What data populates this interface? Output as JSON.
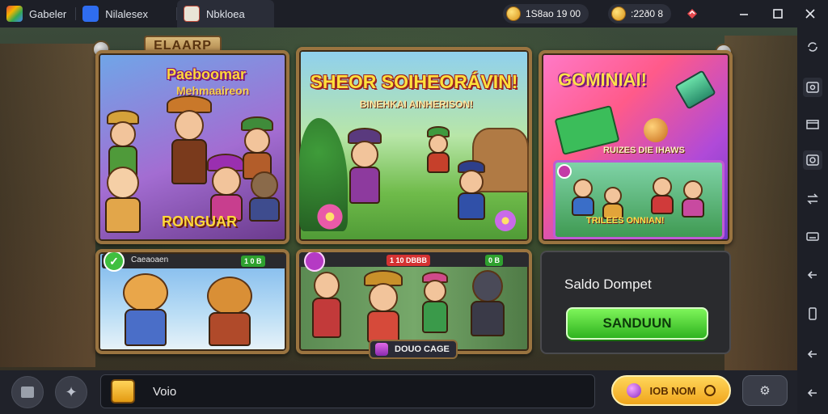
{
  "titlebar": {
    "tabs": [
      {
        "label": "Gabeler",
        "icon": "app-stack-icon"
      },
      {
        "label": "Nilalesex",
        "icon": "app-store-icon"
      },
      {
        "label": "Nbkloea",
        "icon": "game-icon"
      }
    ],
    "wallet_1": "1S8ao 19  00",
    "wallet_2": ":22ð0 8",
    "controls": [
      "gift-icon",
      "minimize-icon",
      "maximize-icon",
      "close-icon"
    ]
  },
  "main": {
    "header_plate": "ELAARP",
    "promos": [
      {
        "title_line1": "Paeboomar",
        "title_line2": "Mehmaaireon",
        "footer": "RONGUAR"
      },
      {
        "title": "SHEOR SOIHEORÁVIN!",
        "subtitle": "BINEHKAI AINHERISON!"
      },
      {
        "title": "GOMINIAI!",
        "subtitle": "RUIZES DIE IHAWS",
        "footer": "TRILEES ONNIAN!"
      }
    ],
    "tiles": [
      {
        "label": "Caeaoaen",
        "tag": "1 0 B"
      },
      {
        "tag_left": "1 10 DBBB",
        "tag_right": "0 B",
        "footer": "DOUO CAGE"
      }
    ],
    "wallet_card": {
      "label": "Saldo Dompet",
      "button": "SANDUUN"
    }
  },
  "bottom": {
    "chat_text": "Voio",
    "gold_pill": "IOB NOM",
    "left_buttons": [
      "inventory-icon",
      "sparkle-icon"
    ]
  },
  "colors": {
    "accent_green": "#2fb31f",
    "gold": "#f0a51c",
    "frame": "#9a7440"
  }
}
